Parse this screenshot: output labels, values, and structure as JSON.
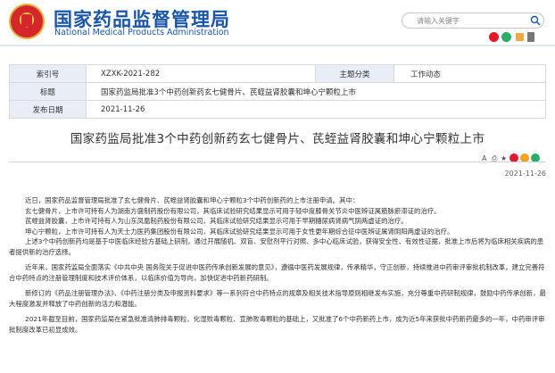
{
  "header": {
    "title": "国家药品监督管理局",
    "subtitle": "National Medical Products Administration",
    "search_placeholder": "请输入关键字",
    "brand_color": "#1a56a8"
  },
  "meta": {
    "index_label": "索引号",
    "index_value": "XZXK-2021-282",
    "category_label": "主题分类",
    "category_value": "工作动态",
    "title_label": "标题",
    "title_value": "国家药监局批准3个中药创新药玄七健骨片、芪蛭益肾胶囊和坤心宁颗粒上市",
    "date_label": "发布日期",
    "date_value": "2021-11-26"
  },
  "article": {
    "title": "国家药监局批准3个中药创新药玄七健骨片、芪蛭益肾胶囊和坤心宁颗粒上市",
    "date": "2021-11-26",
    "tool_font": "A",
    "tool_print": "⎙",
    "tool_star": "★",
    "paragraphs": [
      "近日，国家药品监督管理局批准了玄七健骨片、芪蛭益肾胶囊和坤心宁颗粒3个中药创新药的上市注册申请。其中：",
      "玄七健骨片，上市许可持有人为湖南方盛制药股份有限公司，其临床试验研究结果显示可用于轻中度膝骨关节炎中医辨证属筋脉瘀滞证的治疗。",
      "芪蛭益肾胶囊，上市许可持有人为山东凤凰制药股份有限公司，其临床试验研究结果显示可用于早期糖尿病肾病气阴两虚证的治疗。",
      "坤心宁颗粒，上市许可持有人为天士力医药集团股份有限公司，其临床试验研究结果显示可用于女性更年期综合征中医辨证属肾阴阳两虚证的治疗。",
      "上述3个中药创新药均是基于中医临床经验方基础上研制，通过开展随机、双盲、安慰剂平行对照、多中心临床试验，获得安全性、有效性证据，批准上市后将为临床相关疾病的患者提供新的治疗选择。",
      "近年来，国家药监局全面落实《中共中央 国务院关于促进中医药传承创新发展的意见》，遵循中医药发展规律，传承精华，守正创新，持续推进中药审评审批机制改革，建立完善符合中药特点的注册管理制度和技术评价体系，以临床价值为导向，加快促进中药新药研制。",
      "新修订的《药品注册管理办法》、《中药注册分类及申报资料要求》等一系列符合中药特点的规章及相关技术指导原则相继发布实施，充分尊重中药研制规律，鼓励中药传承创新，最大程度激发并释放了中药创新的活力和潜能。",
      "2021年截至目前，国家药监局在紧急批准清肺排毒颗粒、化湿败毒颗粒、宣肺败毒颗粒的基础上，又批准了6个中药新药上市，成为近5年来获批中药新药最多的一年，中药审评审批制度改革已初显成效。"
    ]
  }
}
